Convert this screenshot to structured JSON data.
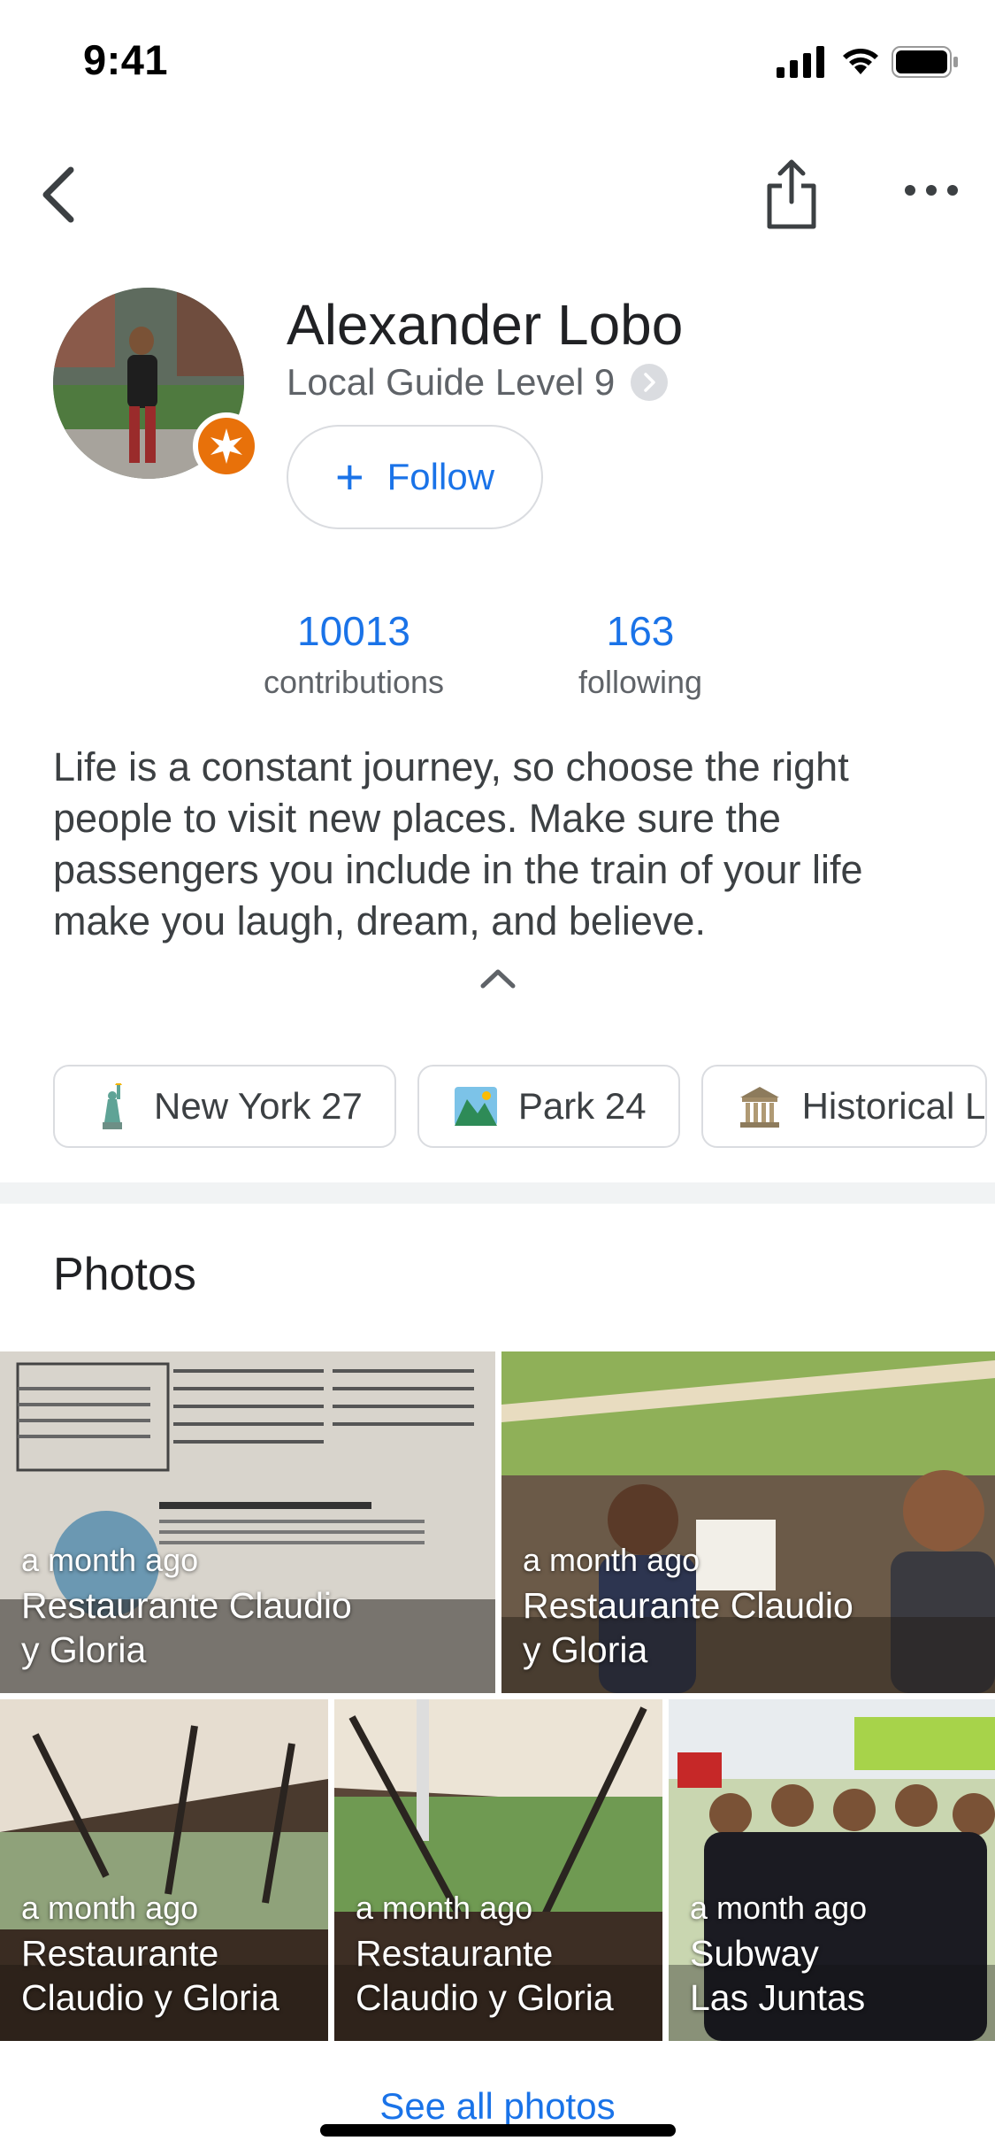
{
  "status_bar": {
    "time": "9:41"
  },
  "profile": {
    "name": "Alexander Lobo",
    "level": "Local Guide Level 9",
    "follow_label": "Follow",
    "follow_icon": "plus-icon"
  },
  "stats": [
    {
      "value": "10013",
      "label": "contributions"
    },
    {
      "value": "163",
      "label": "following"
    }
  ],
  "bio": "Life is a constant journey, so choose the right people to visit new places. Make sure the passengers you include in the train of your life make you laugh, dream, and believe.",
  "chips": [
    {
      "icon": "statue-of-liberty-icon",
      "label": "New York 27"
    },
    {
      "icon": "park-icon",
      "label": "Park 24"
    },
    {
      "icon": "classical-building-icon",
      "label": "Historical L"
    }
  ],
  "photos_section": {
    "title": "Photos",
    "items": [
      {
        "when": "a month ago",
        "where_line1": "Restaurante Claudio",
        "where_line2": "y Gloria"
      },
      {
        "when": "a month ago",
        "where_line1": "Restaurante Claudio",
        "where_line2": "y Gloria"
      },
      {
        "when": "a month ago",
        "where_line1": "Restaurante",
        "where_line2": "Claudio y Gloria"
      },
      {
        "when": "a month ago",
        "where_line1": "Restaurante",
        "where_line2": "Claudio y Gloria"
      },
      {
        "when": "a month ago",
        "where_line1": "Subway",
        "where_line2": "Las Juntas"
      }
    ],
    "see_all": "See all photos"
  },
  "colors": {
    "accent": "#1a73e8",
    "badge": "#e8710a",
    "divider": "#f1f3f4"
  }
}
